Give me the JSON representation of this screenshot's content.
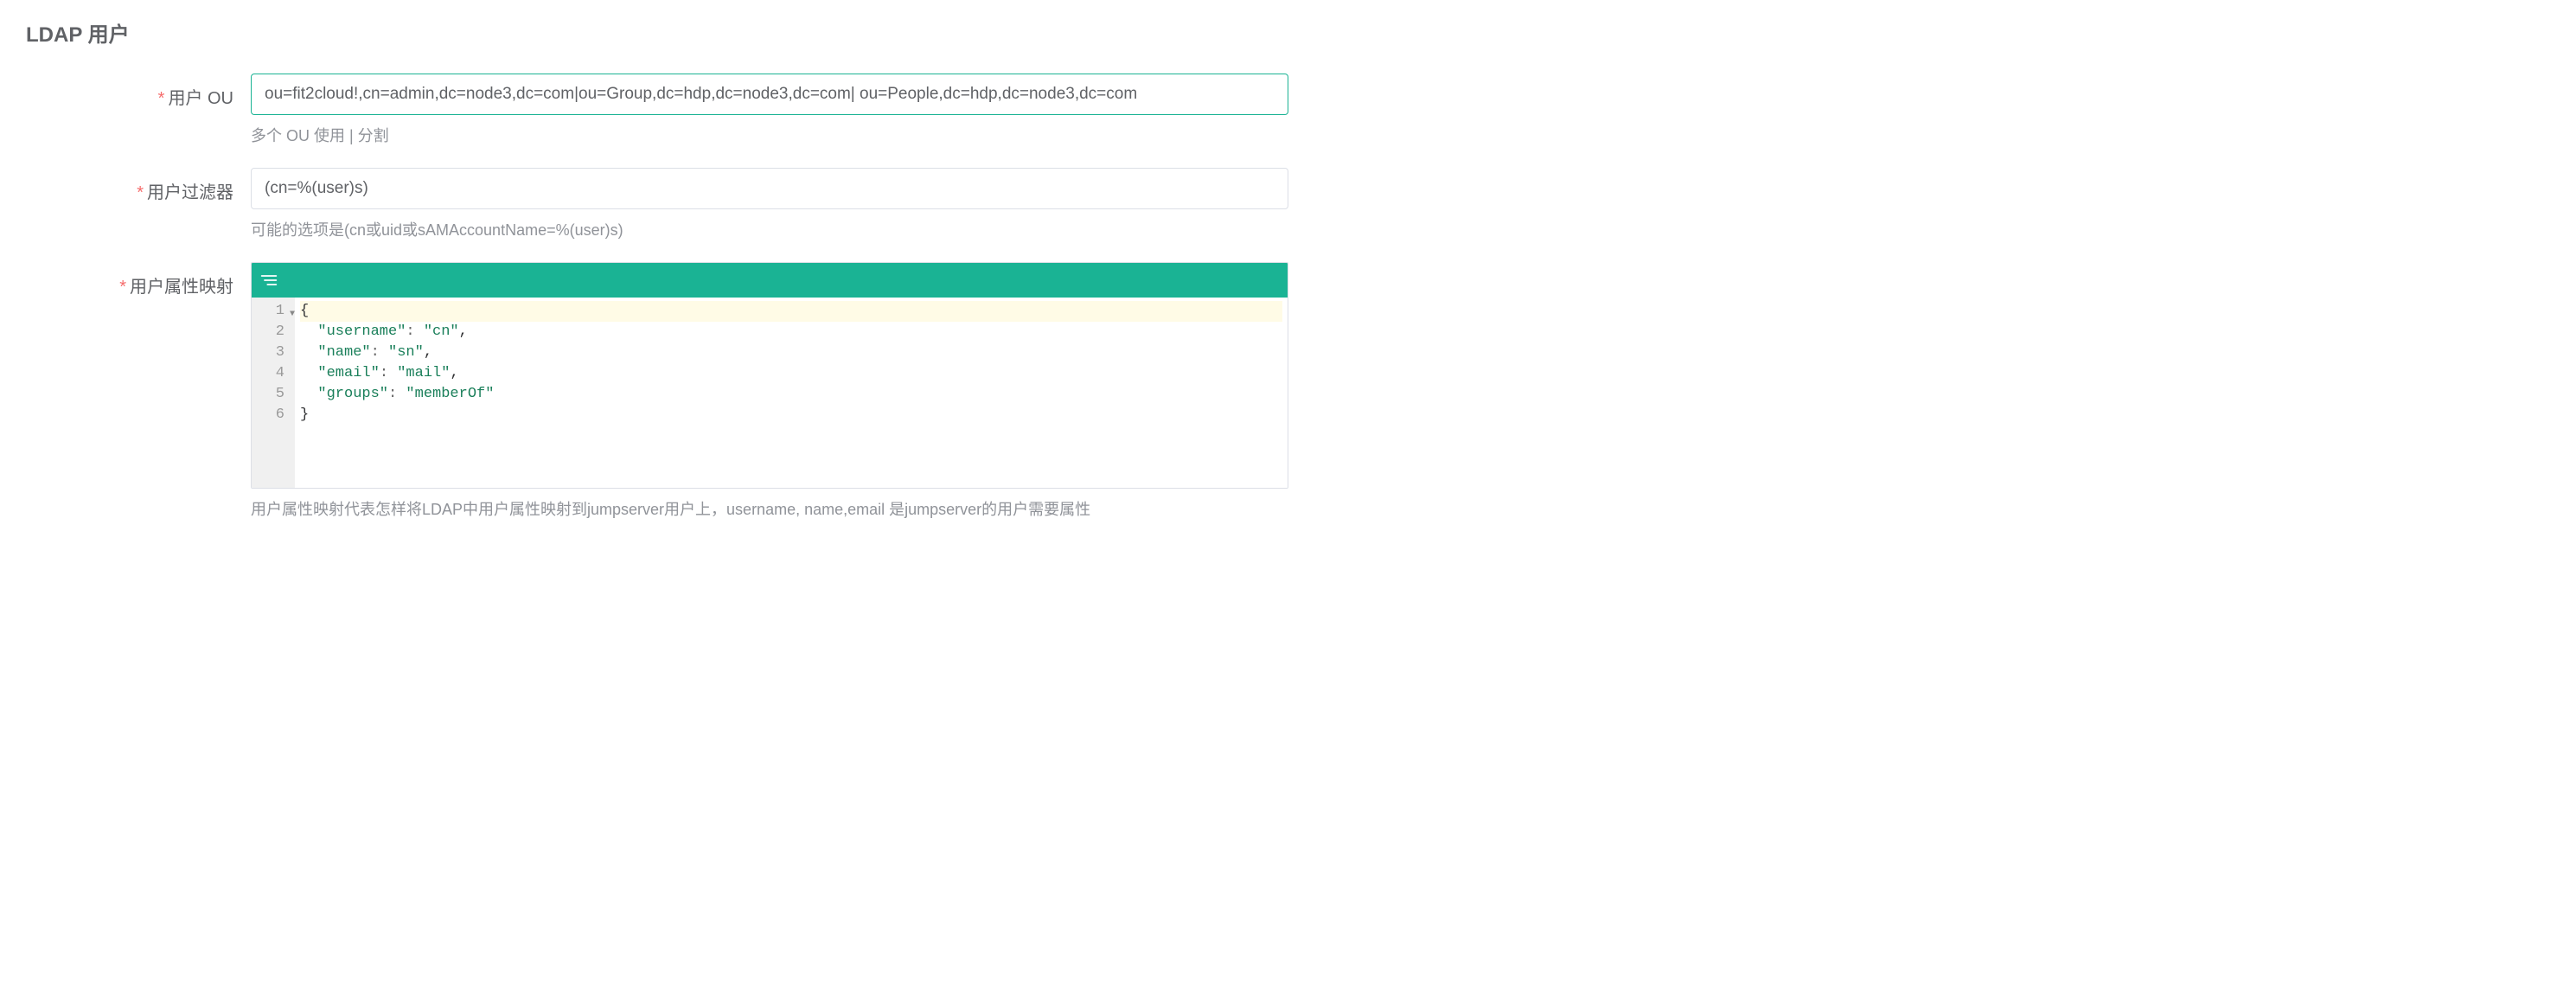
{
  "section": {
    "title": "LDAP 用户"
  },
  "labels": {
    "user_ou": "用户 OU",
    "user_filter": "用户过滤器",
    "attr_map": "用户属性映射"
  },
  "fields": {
    "user_ou": {
      "value": "ou=fit2cloud!,cn=admin,dc=node3,dc=com|ou=Group,dc=hdp,dc=node3,dc=com| ou=People,dc=hdp,dc=node3,dc=com",
      "help": "多个 OU 使用 | 分割"
    },
    "user_filter": {
      "value": "(cn=%(user)s)",
      "help": "可能的选项是(cn或uid或sAMAccountName=%(user)s)"
    },
    "attr_map": {
      "lines": {
        "l1": "1",
        "l2": "2",
        "l3": "3",
        "l4": "4",
        "l5": "5",
        "l6": "6"
      },
      "code": {
        "open_brace": "{",
        "k_username": "\"username\"",
        "v_username": "\"cn\"",
        "k_name": "\"name\"",
        "v_name": "\"sn\"",
        "k_email": "\"email\"",
        "v_email": "\"mail\"",
        "k_groups": "\"groups\"",
        "v_groups": "\"memberOf\"",
        "close_brace": "}",
        "colon": ": ",
        "comma": ","
      },
      "help": "用户属性映射代表怎样将LDAP中用户属性映射到jumpserver用户上，username, name,email 是jumpserver的用户需要属性"
    }
  },
  "required_mark": "*"
}
